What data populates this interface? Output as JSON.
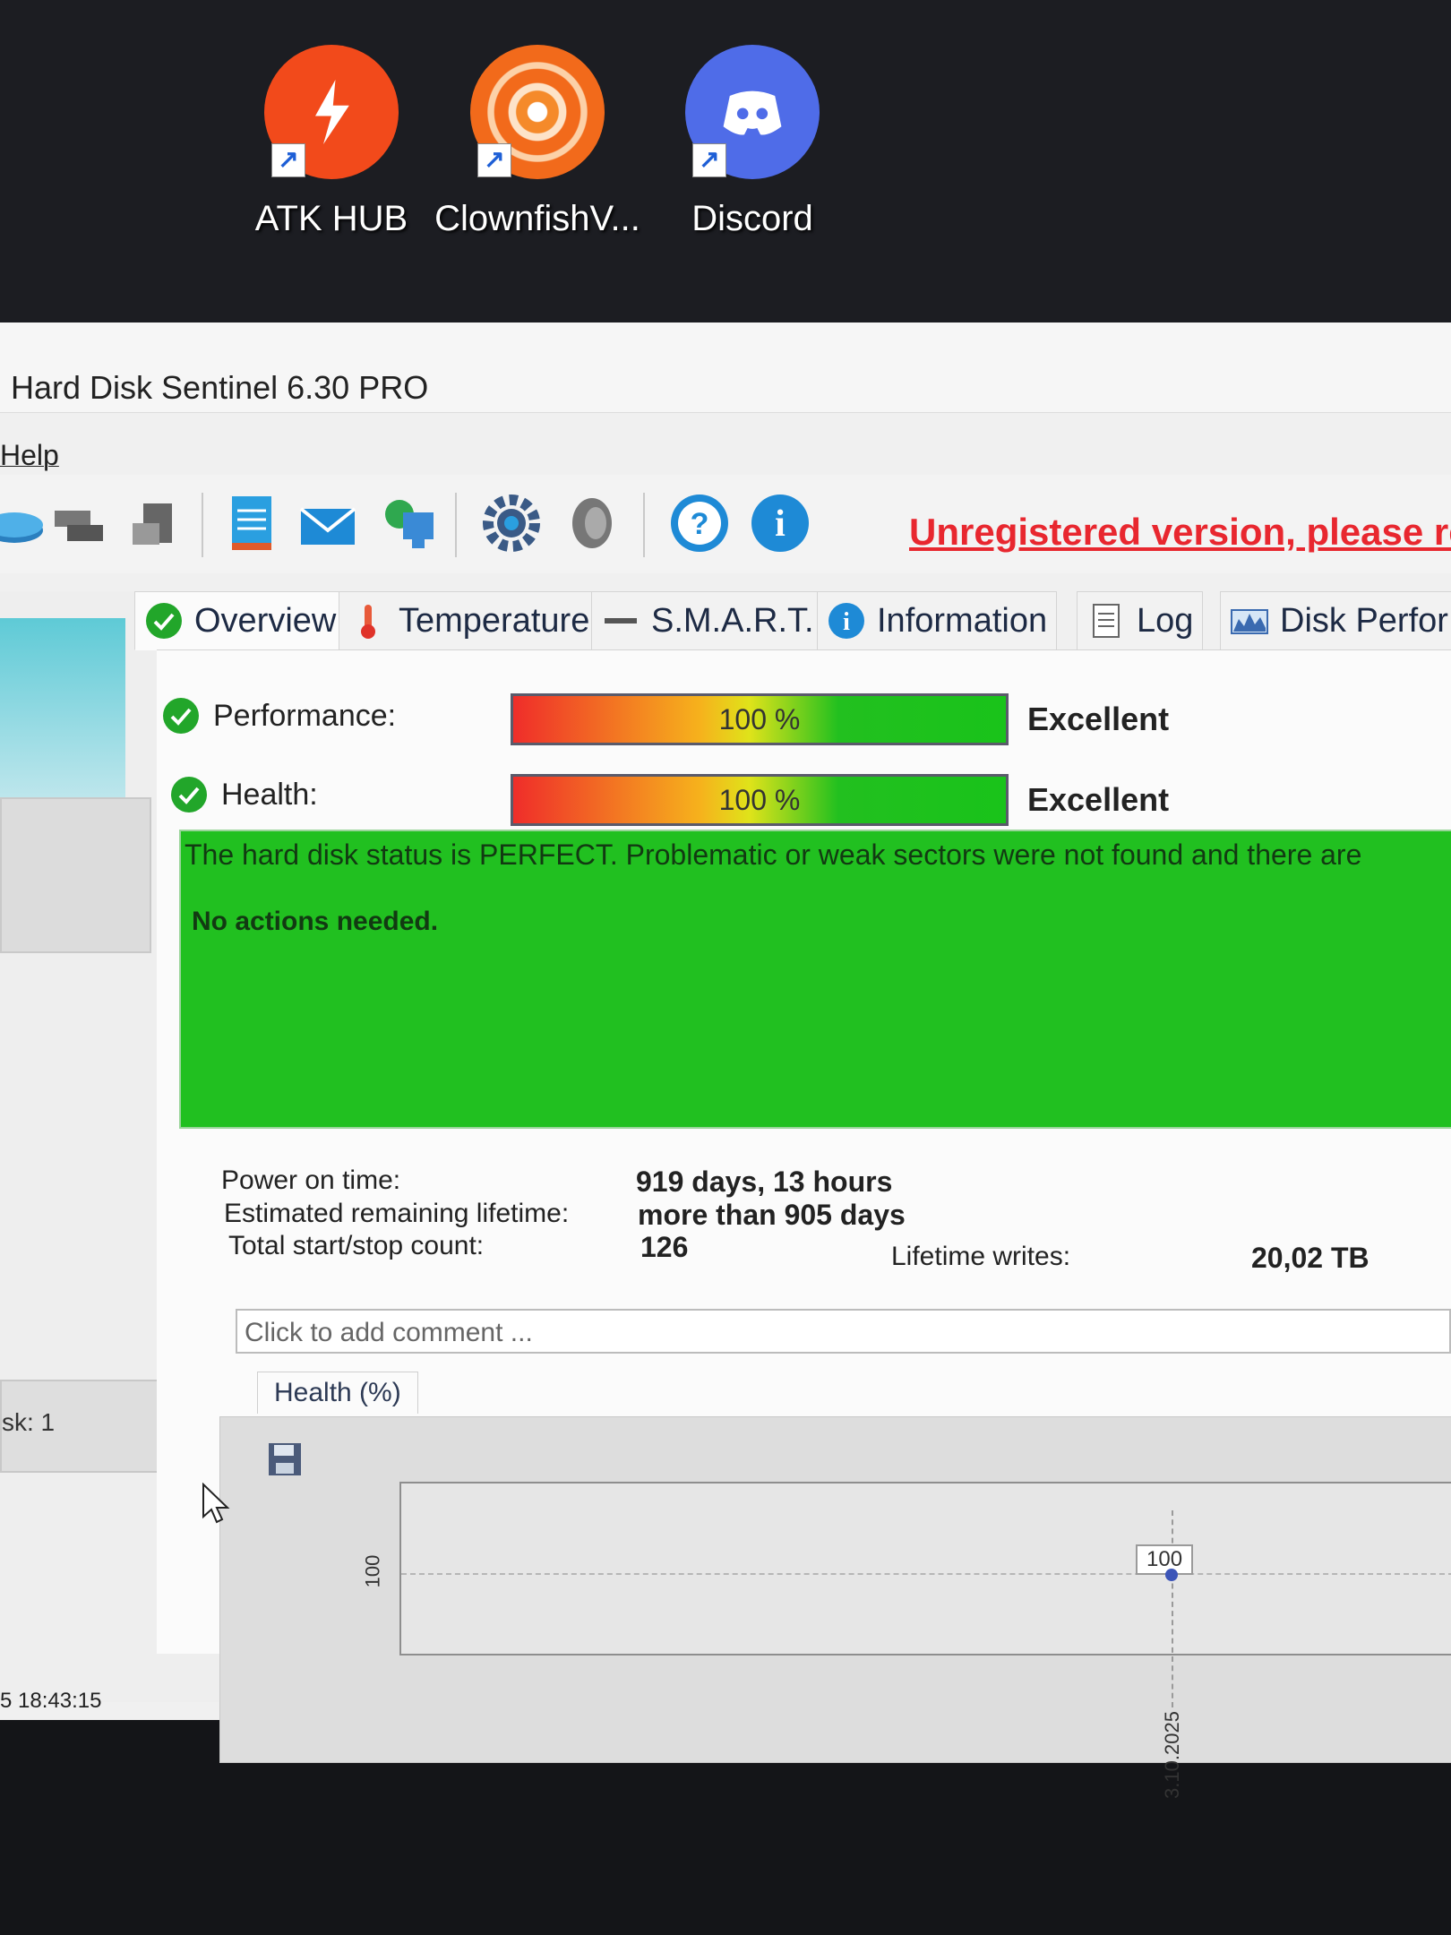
{
  "desktop": {
    "icons": [
      {
        "label": "ATK HUB",
        "icon": "atk-hub-icon",
        "color": "#f24a1b"
      },
      {
        "label": "ClownfishV...",
        "icon": "clownfish-icon",
        "color": "#f26a1b"
      },
      {
        "label": "Discord",
        "icon": "discord-icon",
        "color": "#4f6ce8"
      }
    ]
  },
  "window": {
    "title": "Hard Disk Sentinel 6.30 PRO",
    "menu": {
      "help": "Help"
    },
    "toolbar": {
      "unregistered": "Unregistered version, please re"
    }
  },
  "left_pane": {
    "disk_label": "sk: 1",
    "timestamp": "5 18:43:15"
  },
  "tabs": [
    {
      "label": "Overview",
      "icon": "check-icon"
    },
    {
      "label": "Temperature",
      "icon": "thermometer-icon"
    },
    {
      "label": "S.M.A.R.T.",
      "icon": "smart-icon"
    },
    {
      "label": "Information",
      "icon": "info-icon"
    },
    {
      "label": "Log",
      "icon": "log-icon"
    },
    {
      "label": "Disk Perfor",
      "icon": "disk-performance-icon"
    }
  ],
  "overview": {
    "performance": {
      "label": "Performance:",
      "percent_text": "100 %",
      "rating": "Excellent",
      "value": 100
    },
    "health": {
      "label": "Health:",
      "percent_text": "100 %",
      "rating": "Excellent",
      "value": 100
    },
    "status_line1": "The hard disk status is PERFECT. Problematic or weak sectors were not found and there are",
    "status_line2": "No actions needed.",
    "power_on_label": "Power on time:",
    "power_on_value": "919 days, 13 hours",
    "remaining_label": "Estimated remaining lifetime:",
    "remaining_value": "more than 905 days",
    "startstop_label": "Total start/stop count:",
    "startstop_value": "126",
    "writes_label": "Lifetime writes:",
    "writes_value": "20,02 TB",
    "comment_placeholder": "Click to add comment ..."
  },
  "chart_data": {
    "type": "line",
    "title": "Health (%)",
    "x": [
      "3.10.2025"
    ],
    "series": [
      {
        "values": [
          100
        ]
      }
    ],
    "y_tick": "100",
    "point_label": "100",
    "x_tick": "3.10.2025"
  },
  "colors": {
    "status_green": "#21c020",
    "unregistered_red": "#e8272f"
  }
}
